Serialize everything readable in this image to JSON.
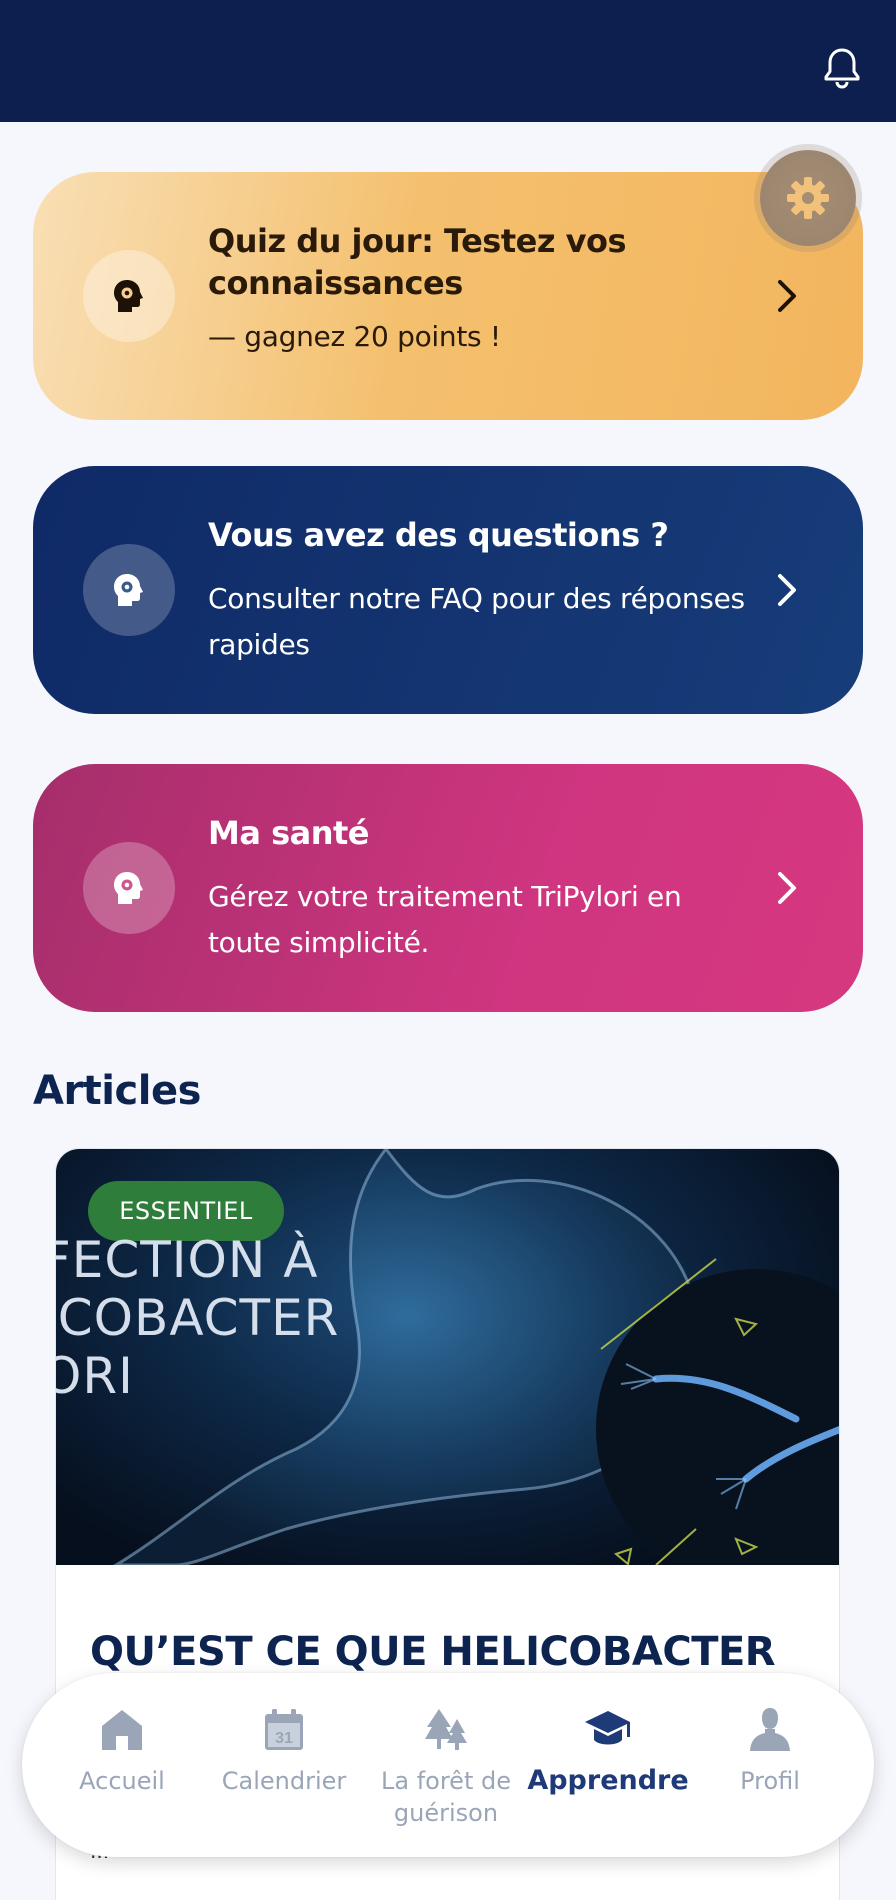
{
  "cards": {
    "quiz": {
      "title": "Quiz du jour: Testez vos connaissances",
      "subtitle": "— gagnez 20 points !"
    },
    "faq": {
      "title": "Vous avez des questions ?",
      "subtitle": "Consulter notre FAQ pour des réponses rapides"
    },
    "health": {
      "title": "Ma santé",
      "subtitle": "Gérez votre traitement TriPylori en toute simplicité."
    }
  },
  "articles": {
    "heading": "Articles",
    "items": [
      {
        "badge": "ESSENTIEL",
        "image_text_lines": [
          "FECTION À",
          "ICOBACTER",
          "ORI"
        ],
        "title": "QU’EST CE QUE HELICOBACTER",
        "more": "..."
      }
    ]
  },
  "nav": {
    "items": [
      {
        "label": "Accueil",
        "icon": "home-icon"
      },
      {
        "label": "Calendrier",
        "icon": "calendar-icon",
        "day": "31"
      },
      {
        "label": "La forêt de guérison",
        "icon": "trees-icon"
      },
      {
        "label": "Apprendre",
        "icon": "graduation-cap-icon",
        "active": true
      },
      {
        "label": "Profil",
        "icon": "profile-icon"
      }
    ]
  },
  "colors": {
    "header": "#0c1f4f",
    "quiz": "#f3b55e",
    "faq": "#173d7a",
    "health": "#cf3580",
    "badge": "#2e7d3a",
    "nav_active": "#1e3a78",
    "nav_inactive": "#9aa6b8"
  }
}
